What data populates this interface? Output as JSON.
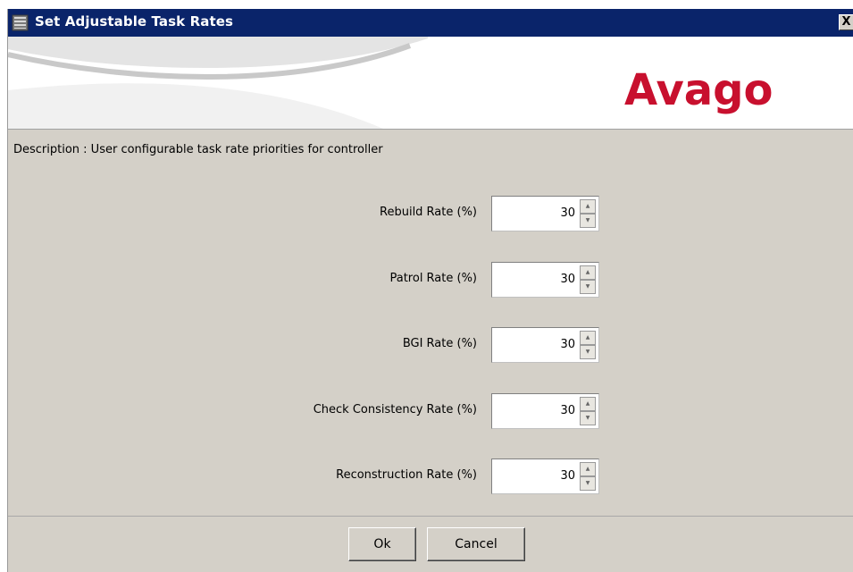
{
  "window": {
    "title": "Set Adjustable Task Rates",
    "close_label": "X"
  },
  "banner": {
    "logo_text": "Avago",
    "logo_color": "#c8102e"
  },
  "description": "Description : User configurable task rate priorities for controller",
  "rates": [
    {
      "label": "Rebuild Rate (%)",
      "value": "30"
    },
    {
      "label": "Patrol Rate (%)",
      "value": "30"
    },
    {
      "label": "BGI Rate (%)",
      "value": "30"
    },
    {
      "label": "Check Consistency Rate (%)",
      "value": "30"
    },
    {
      "label": "Reconstruction Rate (%)",
      "value": "30"
    }
  ],
  "buttons": {
    "ok": "Ok",
    "cancel": "Cancel"
  },
  "icons": {
    "title": "server-icon",
    "spin_up": "arrow-up-icon",
    "spin_down": "arrow-down-icon"
  },
  "colors": {
    "titlebar": "#0a246a",
    "dialog_background": "#d4d0c8"
  }
}
